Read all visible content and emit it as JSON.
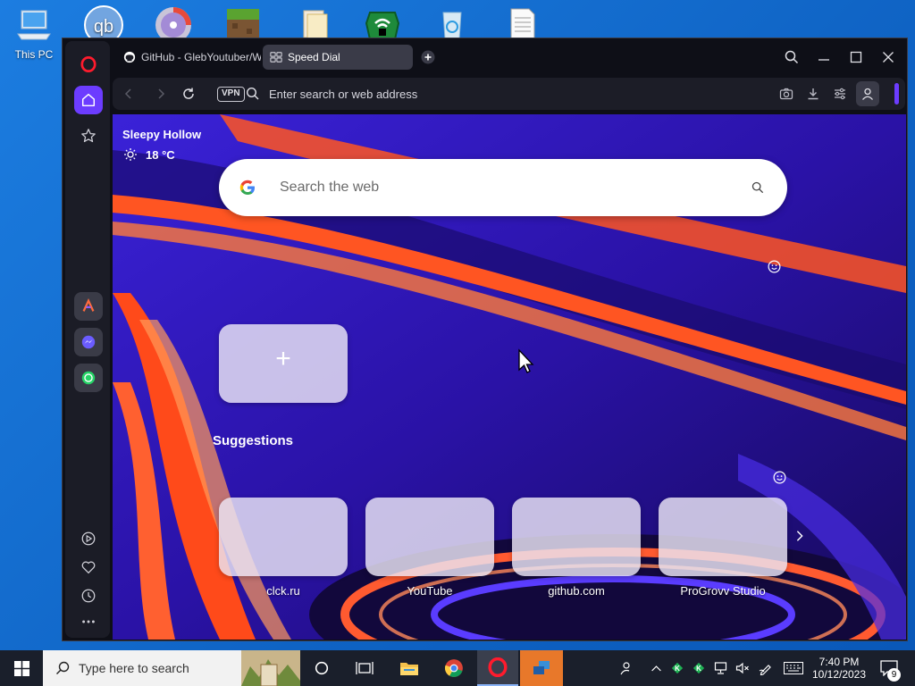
{
  "desktop": {
    "icons": [
      {
        "label": "This PC",
        "icon": "computer-icon"
      },
      {
        "label": "",
        "icon": "qbittorrent-icon"
      },
      {
        "label": "",
        "icon": "dvd-icon"
      },
      {
        "label": "",
        "icon": "minecraft-icon"
      },
      {
        "label": "",
        "icon": "document-folder-icon"
      },
      {
        "label": "",
        "icon": "wifi-lock-icon"
      },
      {
        "label": "",
        "icon": "recycle-bin-icon"
      },
      {
        "label": "",
        "icon": "text-file-icon"
      }
    ]
  },
  "browser": {
    "tabs": [
      {
        "label": "GitHub - GlebYoutuber/W",
        "icon": "github-icon",
        "active": false
      },
      {
        "label": "Speed Dial",
        "icon": "speed-dial-icon",
        "active": true
      }
    ],
    "address": {
      "vpn_label": "VPN",
      "placeholder": "Enter search or web address"
    },
    "sidebar": {
      "top": [
        "opera-logo-icon",
        "home-icon",
        "star-icon"
      ],
      "apps": [
        "aria-icon",
        "messenger-icon",
        "whatsapp-icon"
      ],
      "bottom": [
        "player-icon",
        "heart-icon",
        "history-icon",
        "more-icon"
      ]
    }
  },
  "speed_dial": {
    "weather": {
      "city": "Sleepy Hollow",
      "temp": "18 °C",
      "icon": "sun-icon"
    },
    "search_placeholder": "Search the web",
    "add_tile_symbol": "+",
    "suggestions_title": "Suggestions",
    "suggestions": [
      {
        "label": "clck.ru"
      },
      {
        "label": "YouTube"
      },
      {
        "label": "github.com"
      },
      {
        "label": "ProGrovv Studio"
      }
    ]
  },
  "taskbar": {
    "search_placeholder": "Type here to search",
    "time": "7:40 PM",
    "date": "10/12/2023",
    "notifications": "9"
  },
  "colors": {
    "opera_red": "#ff1b2d",
    "active_sidebar": "#6c3cff",
    "wallpaper_orange": "#ff5522",
    "wallpaper_purple": "#3b1fd6"
  }
}
